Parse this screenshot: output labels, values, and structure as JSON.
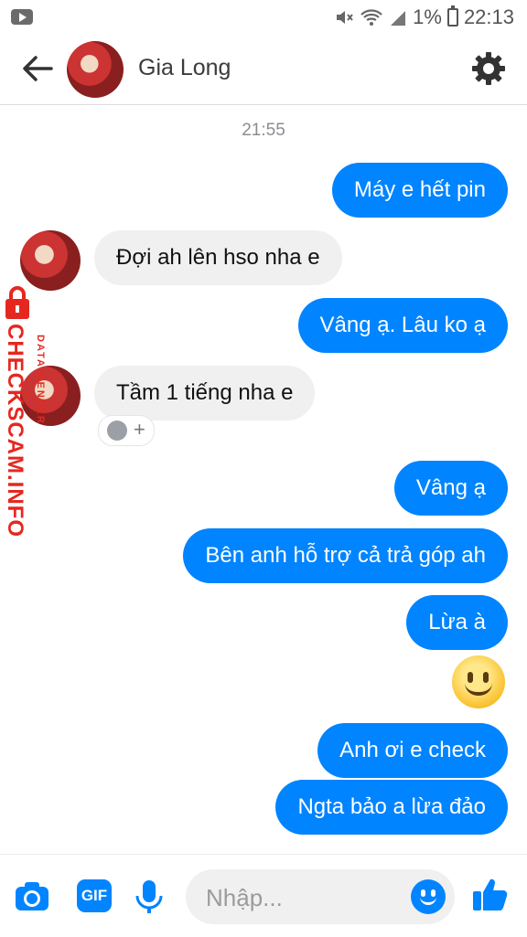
{
  "status_bar": {
    "battery": "1%",
    "time": "22:13"
  },
  "header": {
    "contact_name": "Gia Long"
  },
  "conversation": {
    "timestamp": "21:55",
    "messages": [
      {
        "direction": "out",
        "text": "Máy e hết pin"
      },
      {
        "direction": "in",
        "text": "Đợi ah lên hso nha e"
      },
      {
        "direction": "out",
        "text": "Vâng ạ. Lâu ko ạ"
      },
      {
        "direction": "in",
        "text": "Tầm 1 tiếng nha e"
      },
      {
        "direction": "out",
        "text": "Vâng ạ"
      },
      {
        "direction": "out",
        "text": "Bên anh hỗ trợ cả trả góp ah"
      },
      {
        "direction": "out",
        "text": "Lừa à"
      },
      {
        "direction": "out",
        "emoji": "smiling-face"
      },
      {
        "direction": "out",
        "text": "Anh ơi e check"
      },
      {
        "direction": "out",
        "text": "Ngta bảo a lừa đảo"
      }
    ]
  },
  "watermark": {
    "main": "CHECKSCAM.INFO",
    "sub": "DATA CENTER"
  },
  "composer": {
    "gif_label": "GIF",
    "placeholder": "Nhập..."
  },
  "colors": {
    "accent": "#0084ff",
    "incoming_bubble": "#f1f0f0",
    "watermark_red": "#e5281f"
  }
}
